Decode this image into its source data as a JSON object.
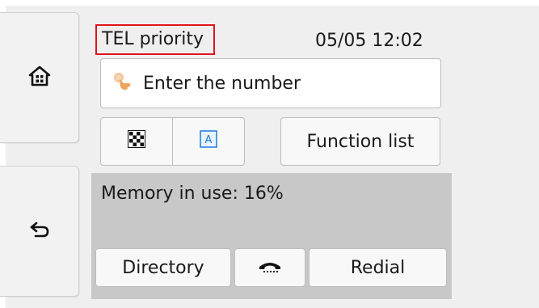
{
  "header": {
    "mode_label": "TEL priority",
    "datetime": "05/05 12:02"
  },
  "number_field": {
    "placeholder": "Enter the number",
    "icon": "finger-tap-icon"
  },
  "toolbar": {
    "quality_icon": "checkerboard-icon",
    "scan_icon": "scan-contrast-icon",
    "function_list_label": "Function list"
  },
  "status": {
    "memory_text": "Memory in use: 16%"
  },
  "bottom_buttons": {
    "directory_label": "Directory",
    "hook_icon": "on-hook-icon",
    "redial_label": "Redial"
  },
  "side": {
    "home_icon": "home-icon",
    "back_icon": "back-arrow-icon"
  },
  "colors": {
    "highlight_border": "#e0141e",
    "panel_gray": "#c8c8c8",
    "background": "#f0eff0"
  }
}
